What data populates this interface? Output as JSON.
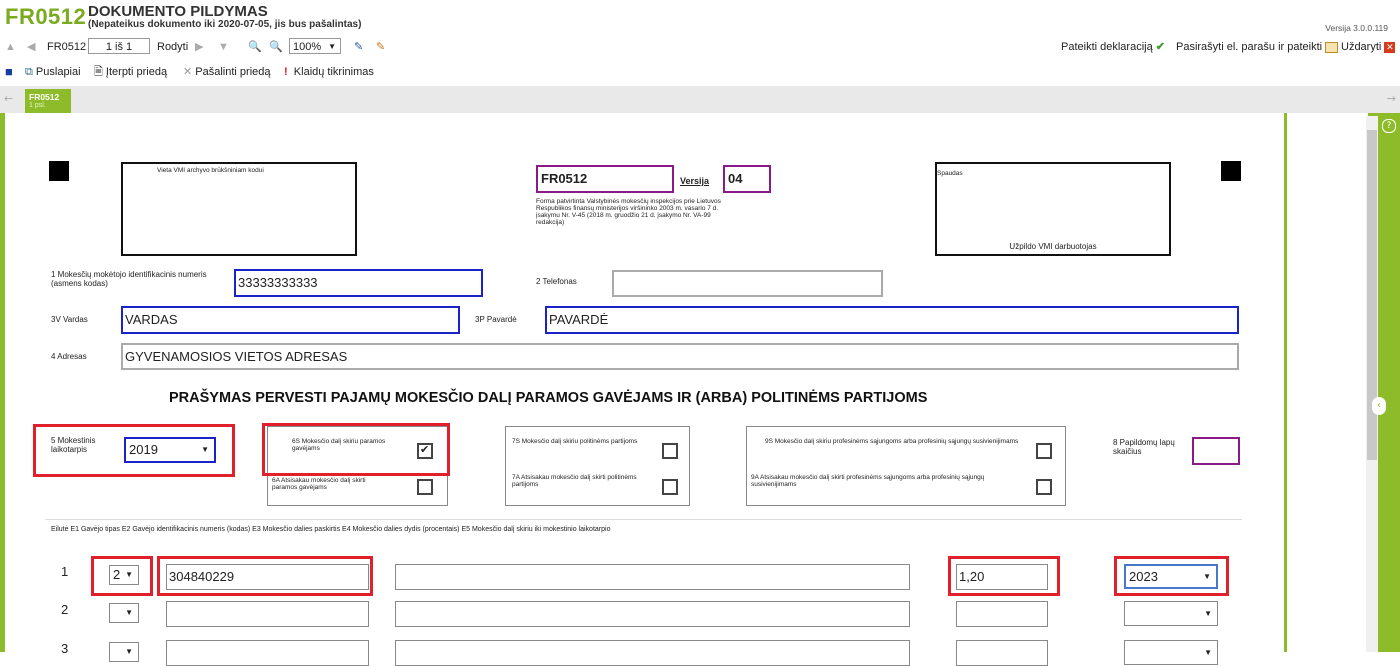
{
  "header": {
    "code": "FR0512",
    "title": "DOKUMENTO PILDYMAS",
    "subtitle": "(Nepateikus dokumento iki 2020-07-05, jis bus pašalintas)",
    "version": "Versija 3.0.0.119"
  },
  "toolbar": {
    "form_name": "FR0512",
    "page_indicator": "1 iš 1",
    "show_label": "Rodyti",
    "zoom": "100%",
    "submit_label": "Pateikti deklaraciją",
    "sign_label": "Pasirašyti el. parašu ir pateikti",
    "close_label": "Uždaryti"
  },
  "toolbar2": {
    "pages_label": "Puslapiai",
    "insert_label": "Įterpti priedą",
    "remove_label": "Pašalinti priedą",
    "errors_label": "Klaidų tikrinimas"
  },
  "tab": {
    "name": "FR0512",
    "page": "1 psl."
  },
  "form": {
    "archive_label": "Vieta VMI archyvo brūkšniniam kodui",
    "form_code": "FR0512",
    "version_label": "Versija",
    "version_value": "04",
    "approval_text": "Forma patvirtinta Valstybinės mokesčių inspekcijos prie Lietuvos Respublikos finansų ministerijos viršininko 2003 m. vasario 7 d. įsakymu Nr. V-45 (2018 m. gruodžio 21 d. įsakymo Nr. VA-99 redakcija)",
    "stamp_label": "Spaudas",
    "stamp_footer": "Užpildo VMI darbuotojas",
    "f1_label": "1 Mokesčių mokėtojo identifikacinis numeris (asmens kodas)",
    "f1_value": "33333333333",
    "f2_label": "2 Telefonas",
    "f2_value": "",
    "f3v_label": "3V Vardas",
    "f3v_value": "VARDAS",
    "f3p_label": "3P Pavardė",
    "f3p_value": "PAVARDĖ",
    "f4_label": "4 Adresas",
    "f4_value": "GYVENAMOSIOS VIETOS ADRESAS",
    "heading": "PRAŠYMAS PERVESTI PAJAMŲ MOKESČIO DALĮ PARAMOS GAVĖJAMS IR (ARBA) POLITINĖMS PARTIJOMS",
    "f5_label": "5 Mokestinis laikotarpis",
    "f5_value": "2019",
    "f6s_label": "6S Mokesčio dalį skiriu paramos gavėjams",
    "f6s_checked": true,
    "f6a_label": "6A Atsisakau mokesčio dalį skirti paramos gavėjams",
    "f7s_label": "7S Mokesčio dalį skiriu politinėms partijoms",
    "f7a_label": "7A Atsisakau mokesčio dalį skirti politinėms partijoms",
    "f9s_label": "9S Mokesčio dalį skiriu profesinėms sąjungoms arba profesinių sąjungų susivienijimams",
    "f9a_label": "9A Atsisakau mokesčio dalį skirti profesinėms sąjungoms arba profesinių sąjungų susivienijimams",
    "f8_label": "8 Papildomų lapų skaičius",
    "f8_value": "",
    "table_header": "Eilutė E1 Gavėjo tipas E2 Gavėjo identifikacinis numeris (kodas) E3 Mokesčio dalies paskirtis E4 Mokesčio dalies dydis (procentais) E5 Mokesčio dalį skiriu iki mokestinio laikotarpio"
  },
  "rows": [
    {
      "num": "1",
      "type": "2",
      "code": "304840229",
      "purpose": "",
      "percent": "1,20",
      "until": "2023"
    },
    {
      "num": "2",
      "type": "",
      "code": "",
      "purpose": "",
      "percent": "",
      "until": ""
    },
    {
      "num": "3",
      "type": "",
      "code": "",
      "purpose": "",
      "percent": "",
      "until": ""
    }
  ],
  "colors": {
    "accent": "#8dbb2a",
    "highlight": "#e0202a",
    "field_blue": "#1a23c8",
    "field_purple": "#8a1a8a"
  }
}
